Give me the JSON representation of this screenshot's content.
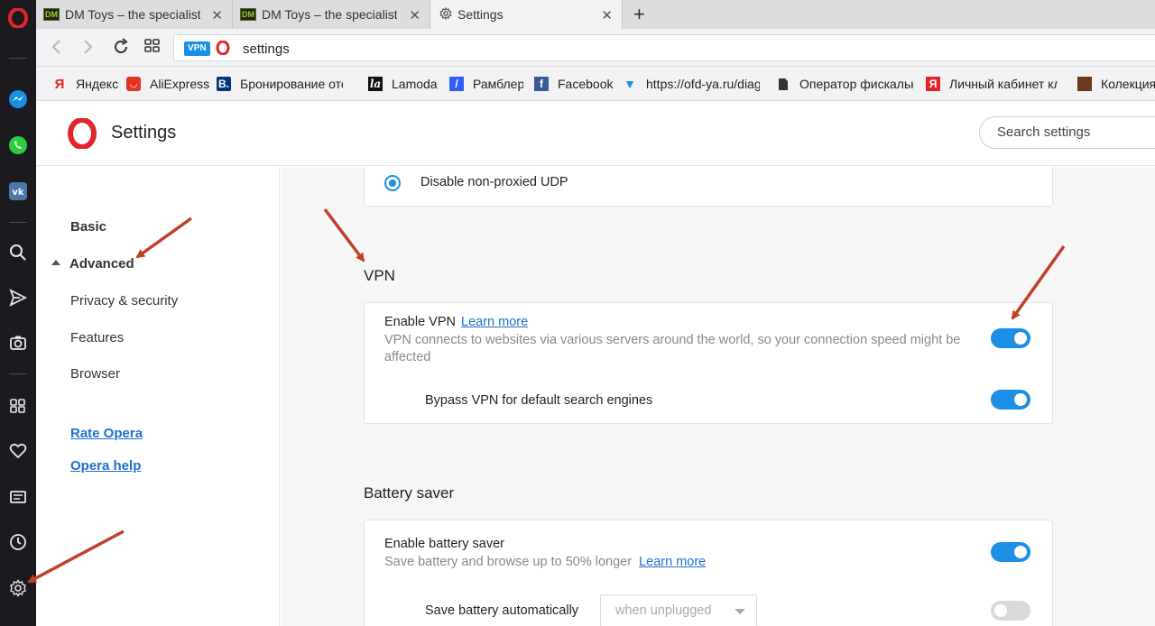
{
  "tabs": [
    {
      "label": "DM Toys – the specialist fo",
      "favicon": "DM"
    },
    {
      "label": "DM Toys – the specialist fo",
      "favicon": "DM"
    },
    {
      "label": "Settings",
      "favicon": "gear-icon"
    }
  ],
  "address": {
    "vpn_badge": "VPN",
    "url": "settings"
  },
  "bookmarks": [
    {
      "label": "Яндекс",
      "icon": "yandex-icon"
    },
    {
      "label": "AliExpress",
      "icon": "aliexpress-icon"
    },
    {
      "label": "Бронирование отеле",
      "icon": "booking-icon"
    },
    {
      "label": "Lamoda",
      "icon": "lamoda-icon"
    },
    {
      "label": "Рамблер",
      "icon": "rambler-icon"
    },
    {
      "label": "Facebook",
      "icon": "facebook-icon"
    },
    {
      "label": "https://ofd-ya.ru/diag",
      "icon": "ofd-icon"
    },
    {
      "label": "Оператор фискальны",
      "icon": "document-icon"
    },
    {
      "label": "Личный кабинет кли",
      "icon": "yandex-icon"
    },
    {
      "label": "Колекция",
      "icon": "collection-icon"
    }
  ],
  "header": {
    "title": "Settings",
    "search_placeholder": "Search settings"
  },
  "nav": {
    "basic": "Basic",
    "advanced": "Advanced",
    "items": [
      "Privacy & security",
      "Features",
      "Browser"
    ],
    "links": [
      "Rate Opera",
      "Opera help"
    ]
  },
  "content": {
    "udp_option": "Disable non-proxied UDP",
    "vpn": {
      "section_title": "VPN",
      "enable_title": "Enable VPN",
      "learn_more": "Learn more",
      "description": "VPN connects to websites via various servers around the world, so your connection speed might be affected",
      "enabled": true,
      "bypass_title": "Bypass VPN for default search engines",
      "bypass_enabled": true
    },
    "battery": {
      "section_title": "Battery saver",
      "enable_title": "Enable battery saver",
      "description": "Save battery and browse up to 50% longer",
      "learn_more": "Learn more",
      "enabled": true,
      "auto_title": "Save battery automatically",
      "auto_select": "when unplugged",
      "auto_enabled": false
    }
  },
  "colors": {
    "accent": "#1a8fe3",
    "opera_red": "#e0262b",
    "annotation_arrow": "#c0402a"
  }
}
